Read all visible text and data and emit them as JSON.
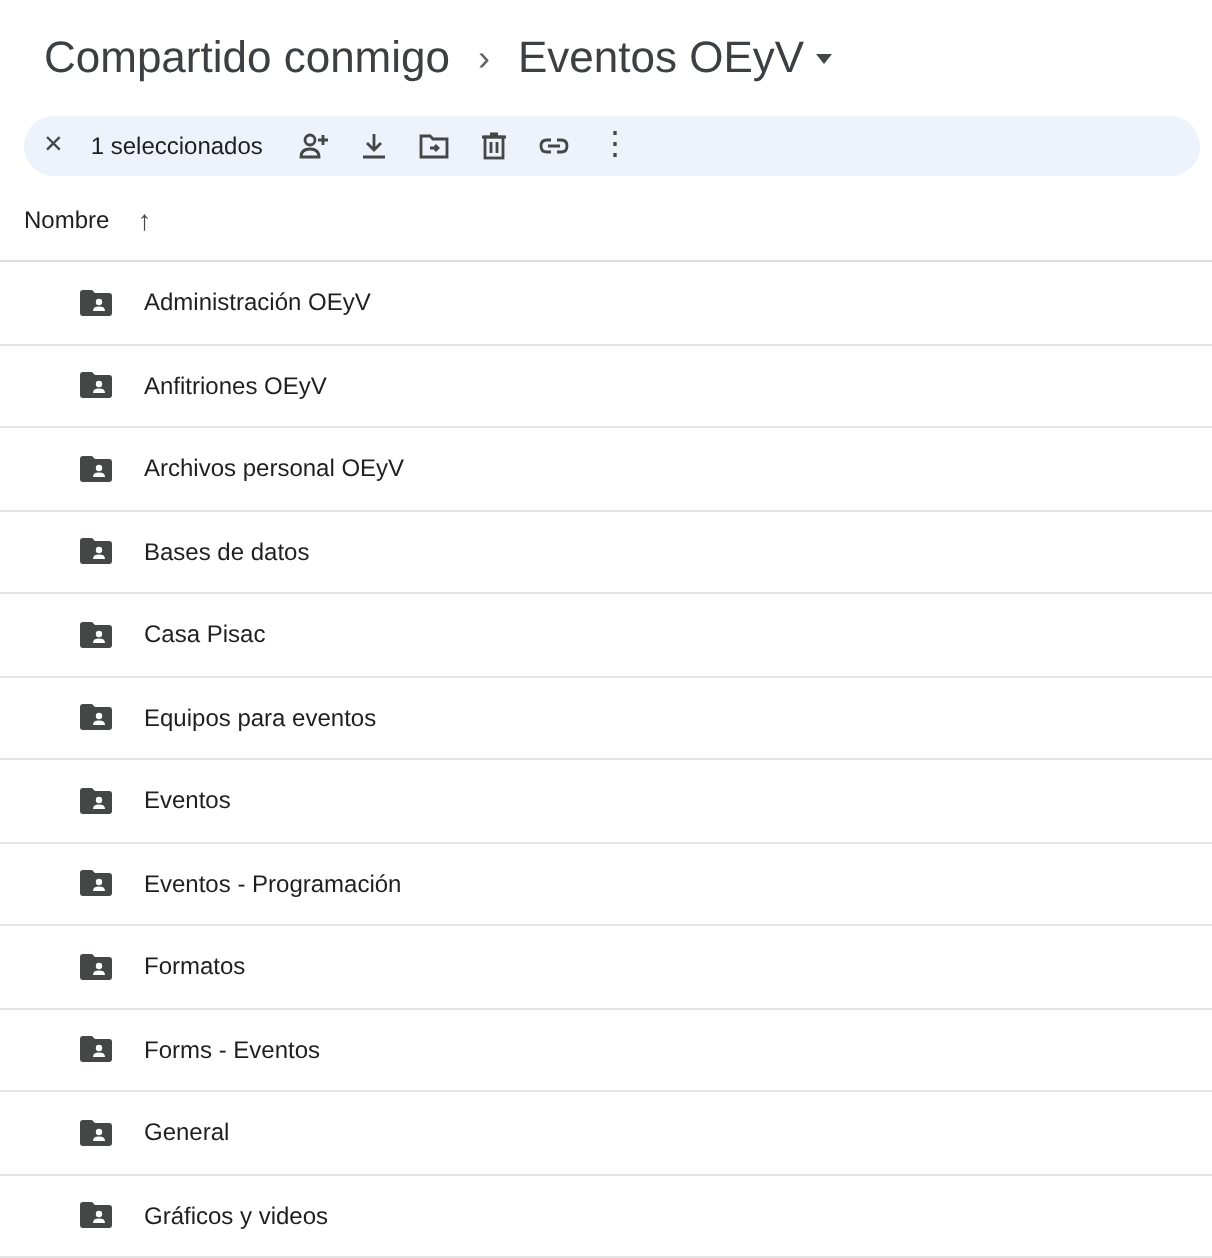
{
  "breadcrumb": {
    "parent": "Compartido conmigo",
    "separator": "›",
    "current": "Eventos OEyV"
  },
  "selection_bar": {
    "close": "×",
    "count": "1 seleccionados",
    "more": "⋮"
  },
  "list_header": {
    "label": "Nombre",
    "sort_arrow": "↑"
  },
  "folders": [
    {
      "name": "Administración OEyV"
    },
    {
      "name": "Anfitriones OEyV"
    },
    {
      "name": "Archivos personal OEyV"
    },
    {
      "name": "Bases de datos"
    },
    {
      "name": "Casa Pisac"
    },
    {
      "name": "Equipos para eventos"
    },
    {
      "name": "Eventos"
    },
    {
      "name": "Eventos - Programación"
    },
    {
      "name": "Formatos"
    },
    {
      "name": "Forms - Eventos"
    },
    {
      "name": "General"
    },
    {
      "name": "Gráficos y videos"
    }
  ]
}
